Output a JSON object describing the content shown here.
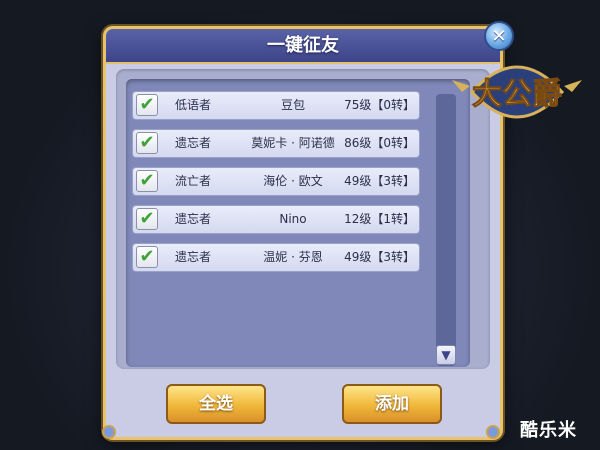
{
  "dialog": {
    "title": "一键征友",
    "close_icon": "close-icon"
  },
  "friends": [
    {
      "checked": true,
      "class": "低语者",
      "name": "豆包",
      "level": "75级【0转】"
    },
    {
      "checked": true,
      "class": "遗忘者",
      "name": "莫妮卡 · 阿诺德",
      "level": "86级【0转】"
    },
    {
      "checked": true,
      "class": "流亡者",
      "name": "海伦 · 欧文",
      "level": "49级【3转】"
    },
    {
      "checked": true,
      "class": "遗忘者",
      "name": "Nino",
      "level": "12级【1转】"
    },
    {
      "checked": true,
      "class": "遗忘者",
      "name": "温妮 · 芬恩",
      "level": "49级【3转】"
    }
  ],
  "buttons": {
    "select_all": "全选",
    "add": "添加"
  },
  "logo": {
    "text": "大公爵"
  },
  "watermark": {
    "text": "酷乐米"
  },
  "colors": {
    "accent_gold": "#f0b73a",
    "title_blue": "#3d4488",
    "check_green": "#3fa33a"
  }
}
